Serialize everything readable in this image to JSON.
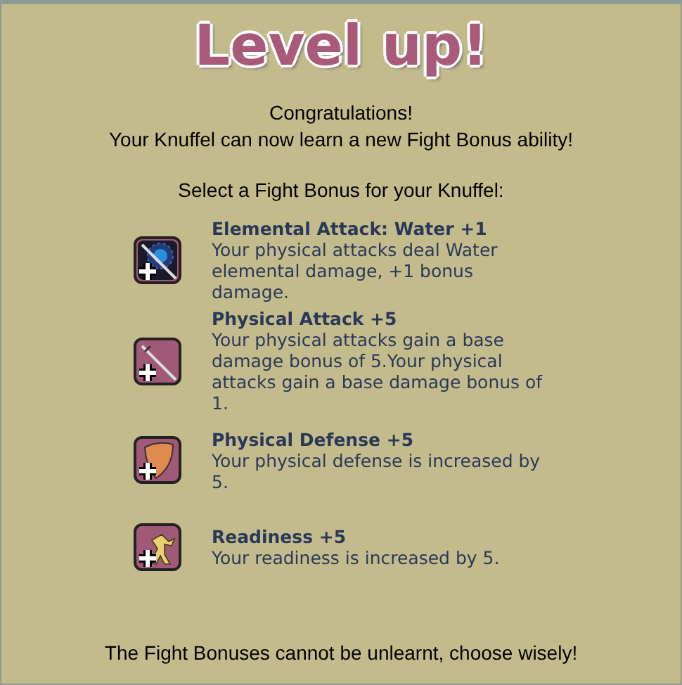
{
  "title": "Level up!",
  "intro": [
    "Congratulations!",
    "Your Knuffel can now learn a new Fight Bonus ability!"
  ],
  "prompt": "Select a Fight Bonus for your Knuffel:",
  "bonuses": [
    {
      "kind": "water",
      "name": "Elemental Attack: Water +1",
      "description": "Your physical attacks deal Water elemental damage, +1 bonus damage."
    },
    {
      "kind": "sword",
      "name": "Physical Attack +5",
      "description": "Your physical attacks gain a base damage bonus of 5.Your physical attacks gain a base damage bonus of 1."
    },
    {
      "kind": "shield",
      "name": "Physical Defense +5",
      "description": "Your physical defense is increased by 5."
    },
    {
      "kind": "runner",
      "name": "Readiness +5",
      "description": "Your readiness is increased by 5."
    }
  ],
  "warning": "The Fight Bonuses cannot be unlearnt, choose wisely!"
}
